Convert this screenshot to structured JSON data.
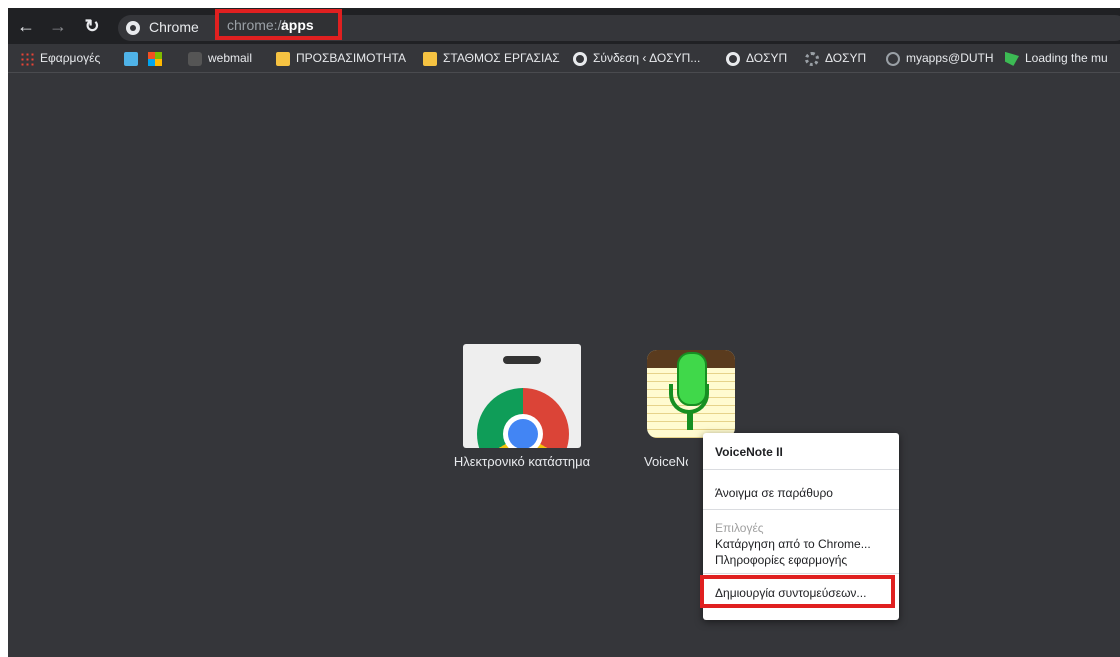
{
  "toolbar": {
    "chip_label": "Chrome",
    "url_scheme": "chrome://",
    "url_path": "apps"
  },
  "bookmarks": {
    "apps": "Εφαρμογές",
    "webmail": "webmail",
    "folder1": "ΠΡΟΣΒΑΣΙΜΟΤΗΤΑ",
    "folder2": "ΣΤΑΘΜΟΣ ΕΡΓΑΣΙΑΣ",
    "login": "Σύνδεση ‹ ΔΟΣΥΠ...",
    "dosyp1": "ΔΟΣΥΠ",
    "dosyp2": "ΔΟΣΥΠ",
    "myapps": "myapps@DUTH",
    "loading": "Loading the mu"
  },
  "apps": [
    {
      "label": "Ηλεκτρονικό κατάστημα"
    },
    {
      "label": "VoiceNote II"
    }
  ],
  "context_menu": {
    "title": "VoiceNote II",
    "open_window": "Άνοιγμα σε παράθυρο",
    "options": "Επιλογές",
    "remove": "Κατάργηση από το Chrome...",
    "info": "Πληροφορίες εφαρμογής",
    "shortcuts": "Δημιουργία συντομεύσεων..."
  }
}
